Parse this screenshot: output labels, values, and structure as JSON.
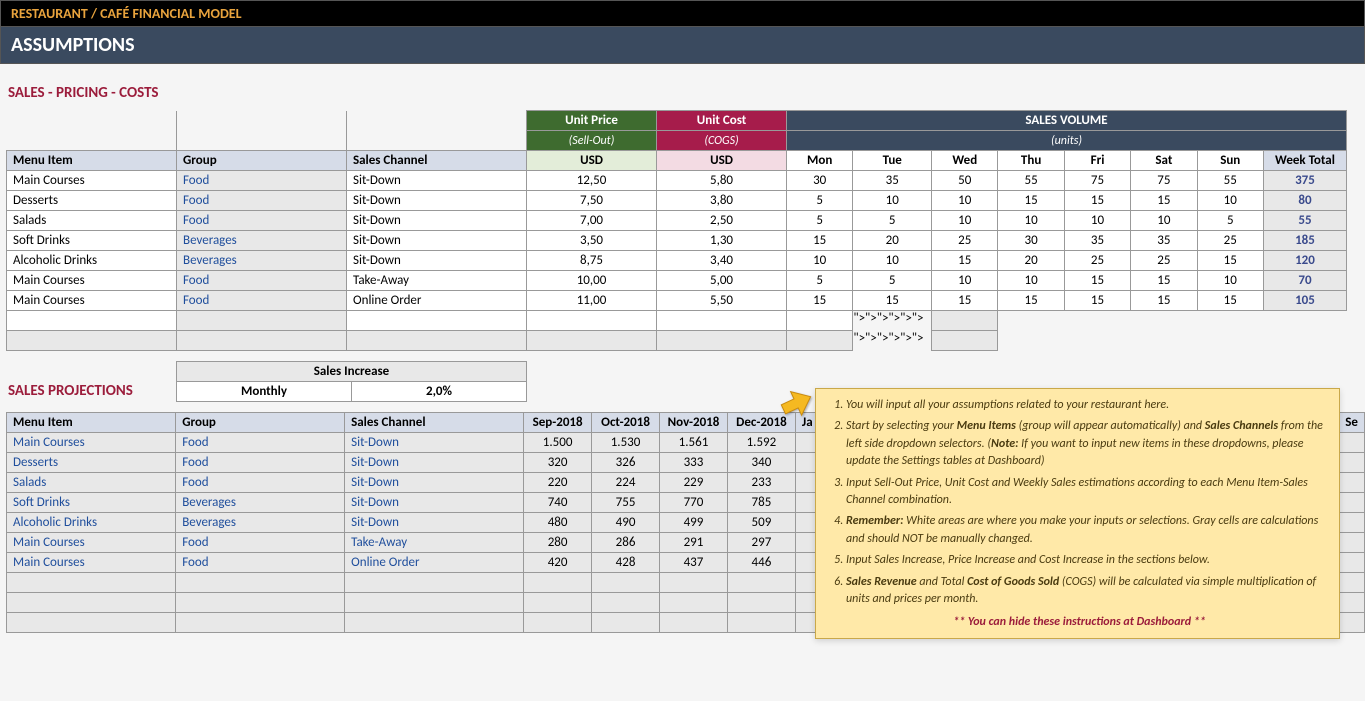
{
  "banner": {
    "top": "RESTAURANT / CAFÉ FINANCIAL MODEL",
    "sub": "ASSUMPTIONS"
  },
  "section1": {
    "title": "SALES - PRICING - COSTS",
    "unitPrice": {
      "label": "Unit Price",
      "sub": "(Sell-Out)",
      "currency": "USD"
    },
    "unitCost": {
      "label": "Unit Cost",
      "sub": "(COGS)",
      "currency": "USD"
    },
    "volume": {
      "label": "SALES VOLUME",
      "sub": "(units)"
    },
    "cols": {
      "menu": "Menu Item",
      "group": "Group",
      "channel": "Sales Channel",
      "weekTotal": "Week Total"
    },
    "days": [
      "Mon",
      "Tue",
      "Wed",
      "Thu",
      "Fri",
      "Sat",
      "Sun"
    ],
    "rows": [
      {
        "menu": "Main Courses",
        "group": "Food",
        "channel": "Sit-Down",
        "price": "12,50",
        "cost": "5,80",
        "vol": [
          "30",
          "35",
          "50",
          "55",
          "75",
          "75",
          "55"
        ],
        "total": "375"
      },
      {
        "menu": "Desserts",
        "group": "Food",
        "channel": "Sit-Down",
        "price": "7,50",
        "cost": "3,80",
        "vol": [
          "5",
          "10",
          "10",
          "15",
          "15",
          "15",
          "10"
        ],
        "total": "80"
      },
      {
        "menu": "Salads",
        "group": "Food",
        "channel": "Sit-Down",
        "price": "7,00",
        "cost": "2,50",
        "vol": [
          "5",
          "5",
          "10",
          "10",
          "10",
          "10",
          "5"
        ],
        "total": "55"
      },
      {
        "menu": "Soft Drinks",
        "group": "Beverages",
        "channel": "Sit-Down",
        "price": "3,50",
        "cost": "1,30",
        "vol": [
          "15",
          "20",
          "25",
          "30",
          "35",
          "35",
          "25"
        ],
        "total": "185"
      },
      {
        "menu": "Alcoholic Drinks",
        "group": "Beverages",
        "channel": "Sit-Down",
        "price": "8,75",
        "cost": "3,40",
        "vol": [
          "10",
          "10",
          "15",
          "20",
          "25",
          "25",
          "15"
        ],
        "total": "120"
      },
      {
        "menu": "Main Courses",
        "group": "Food",
        "channel": "Take-Away",
        "price": "10,00",
        "cost": "5,00",
        "vol": [
          "5",
          "5",
          "10",
          "10",
          "15",
          "15",
          "10"
        ],
        "total": "70"
      },
      {
        "menu": "Main Courses",
        "group": "Food",
        "channel": "Online Order",
        "price": "11,00",
        "cost": "5,50",
        "vol": [
          "15",
          "15",
          "15",
          "15",
          "15",
          "15",
          "15"
        ],
        "total": "105"
      }
    ]
  },
  "salesIncrease": {
    "title": "Sales Increase",
    "label": "Monthly",
    "value": "2,0%"
  },
  "section2": {
    "title": "SALES PROJECTIONS",
    "cols": {
      "menu": "Menu Item",
      "group": "Group",
      "channel": "Sales Channel"
    },
    "months": [
      "Sep-2018",
      "Oct-2018",
      "Nov-2018",
      "Dec-2018",
      "Ja",
      "Se"
    ],
    "rows": [
      {
        "menu": "Main Courses",
        "group": "Food",
        "channel": "Sit-Down",
        "vals": [
          "1.500",
          "1.530",
          "1.561",
          "1.592"
        ]
      },
      {
        "menu": "Desserts",
        "group": "Food",
        "channel": "Sit-Down",
        "vals": [
          "320",
          "326",
          "333",
          "340"
        ]
      },
      {
        "menu": "Salads",
        "group": "Food",
        "channel": "Sit-Down",
        "vals": [
          "220",
          "224",
          "229",
          "233"
        ]
      },
      {
        "menu": "Soft Drinks",
        "group": "Beverages",
        "channel": "Sit-Down",
        "vals": [
          "740",
          "755",
          "770",
          "785"
        ]
      },
      {
        "menu": "Alcoholic Drinks",
        "group": "Beverages",
        "channel": "Sit-Down",
        "vals": [
          "480",
          "490",
          "499",
          "509"
        ]
      },
      {
        "menu": "Main Courses",
        "group": "Food",
        "channel": "Take-Away",
        "vals": [
          "280",
          "286",
          "291",
          "297"
        ]
      },
      {
        "menu": "Main Courses",
        "group": "Food",
        "channel": "Online Order",
        "vals": [
          "420",
          "428",
          "437",
          "446"
        ]
      }
    ]
  },
  "instructions": {
    "items": [
      {
        "pre": "You will input all your assumptions related to your restaurant here."
      },
      {
        "pre": "Start by selecting your ",
        "b1": "Menu Items",
        "mid": " (group will appear automatically) and ",
        "b2": "Sales Channels",
        "post": " from the left side dropdown selectors. (",
        "b3": "Note:",
        "post2": " If you want to input new items in these dropdowns, please update the Settings tables at Dashboard)"
      },
      {
        "pre": "Input Sell-Out Price, Unit Cost and Weekly Sales estimations according to each Menu Item-Sales Channel combination."
      },
      {
        "b1": "Remember:",
        "post": " White areas are where you make your inputs or selections. Gray cells are calculations and should NOT be manually changed."
      },
      {
        "pre": "Input Sales Increase, Price Increase and Cost Increase in the sections below."
      },
      {
        "b1": "Sales Revenue",
        "mid": " and Total ",
        "b2": "Cost of Goods Sold",
        "post": " (COGS) will be calculated via simple multiplication of units and prices per month."
      }
    ],
    "footer": "** You can hide these instructions at Dashboard **"
  }
}
